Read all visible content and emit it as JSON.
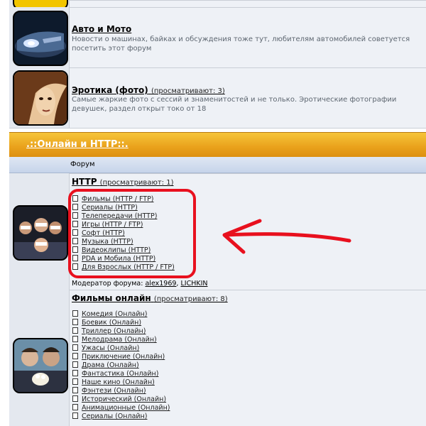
{
  "forums_top": [
    {
      "title": "Авто и Мото",
      "desc": "Новости о машинах, байках и обсуждения тоже тут, любителям автомобилей советуется посетить этот форум"
    },
    {
      "title": "Эротика (фото)",
      "viewing": "(просматривают: 3)",
      "desc": "Самые жаркие фото с сессий и знаменитостей и не только. Эротические фотографии девушек, раздел открыт токо от 18"
    }
  ],
  "category": {
    "title": ".::Онлайн и HTTP::."
  },
  "table_header": {
    "forum_col": "Форум"
  },
  "http_forum": {
    "title": "HTTP",
    "viewing": "(просматривают: 1)",
    "subforums": [
      "Фильмы (HTTP / FTP)",
      "Сериалы (HTTP)",
      "Телепередачи (HTTP)",
      "Игры (HTTP / FTP)",
      "Софт (HTTP)",
      "Музыка (HTTP)",
      "Видеоклипы (HTTP)",
      "PDA и Мобила (HTTP)",
      "Для Взрослых (HTTP / FTP)"
    ],
    "moderator_label": "Модератор форума:",
    "moderators": [
      "alex1969",
      "LICHKIN"
    ]
  },
  "films_forum": {
    "title": "Фильмы онлайн",
    "viewing": "(просматривают: 8)",
    "subforums": [
      "Комедия (Онлайн)",
      "Боевик (Онлайн)",
      "Триллер (Онлайн)",
      "Мелодрама (Онлайн)",
      "Ужасы (Онлайн)",
      "Приключение (Онлайн)",
      "Драма (Онлайн)",
      "Фантастика (Онлайн)",
      "Наше кино (Онлайн)",
      "Фэнтези (Онлайн)",
      "Исторический (Онлайн)",
      "Анимационные (Онлайн)",
      "Сериалы (Онлайн)"
    ]
  },
  "colors": {
    "category_bar": "#e9a11b",
    "annotation_red": "#e8101e",
    "row_bg": "#eef1f6"
  }
}
